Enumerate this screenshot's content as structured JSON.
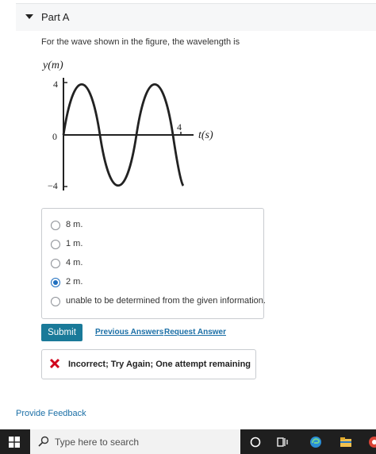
{
  "part": {
    "title": "Part A"
  },
  "question": {
    "text": "For the wave shown in the figure, the wavelength is"
  },
  "figure": {
    "y_label": "y(m)",
    "x_label": "t(s)",
    "y_ticks": [
      "4",
      "0",
      "−4"
    ],
    "x_tick": "4"
  },
  "choices": [
    {
      "label": "8 m.",
      "selected": false
    },
    {
      "label": "1 m.",
      "selected": false
    },
    {
      "label": "4 m.",
      "selected": false
    },
    {
      "label": "2 m.",
      "selected": true
    },
    {
      "label": "unable to be determined from the given information.",
      "selected": false
    }
  ],
  "actions": {
    "submit_label": "Submit",
    "previous_answers_label": "Previous Answers",
    "request_answer_label": "Request Answer"
  },
  "feedback": {
    "message": "Incorrect; Try Again; One attempt remaining"
  },
  "footer": {
    "provide_feedback_label": "Provide Feedback"
  },
  "taskbar": {
    "search_placeholder": "Type here to search"
  },
  "colors": {
    "accent": "#1a7a99",
    "link": "#1b6fa6",
    "error": "#d0021b",
    "radio_selected": "#1f6fbf"
  }
}
